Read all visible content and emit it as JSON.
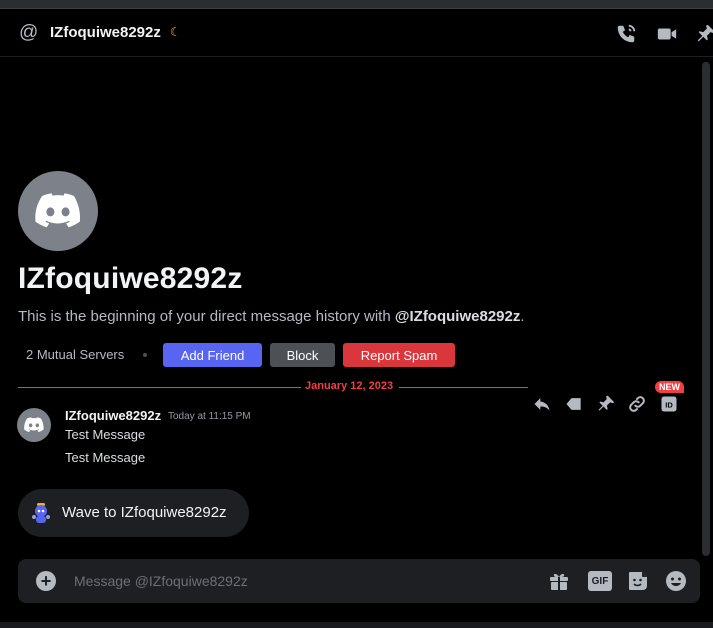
{
  "header": {
    "title": "IZfoquiwe8292z",
    "at_symbol": "@",
    "status_icon": "moon-idle-icon",
    "icons": [
      "phone-call-icon",
      "video-call-icon",
      "pin-icon"
    ]
  },
  "profile": {
    "name": "IZfoquiwe8292z",
    "intro_prefix": "This is the beginning of your direct message history with ",
    "intro_handle": "@IZfoquiwe8292z",
    "intro_suffix": ".",
    "mutual_servers": "2 Mutual Servers",
    "buttons": {
      "add_friend": "Add Friend",
      "block": "Block",
      "report_spam": "Report Spam"
    }
  },
  "divider": {
    "date": "January 12, 2023"
  },
  "toolbar": {
    "icons": [
      "reply-icon",
      "mark-unread-icon",
      "pin-icon",
      "copy-link-icon",
      "copy-id-icon"
    ],
    "new_badge": "NEW"
  },
  "message": {
    "author": "IZfoquiwe8292z",
    "timestamp": "Today at 11:15 PM",
    "lines": [
      "Test Message",
      "Test Message"
    ]
  },
  "wave": {
    "label": "Wave to IZfoquiwe8292z"
  },
  "composer": {
    "placeholder": "Message @IZfoquiwe8292z",
    "gif_label": "GIF",
    "icons": [
      "add-attachment-icon",
      "gift-icon",
      "gif-icon",
      "sticker-icon",
      "emoji-icon"
    ]
  },
  "colors": {
    "blurple": "#5865f2",
    "danger": "#da373c",
    "divider_red": "#f23f43",
    "idle_yellow": "#f0b232"
  }
}
